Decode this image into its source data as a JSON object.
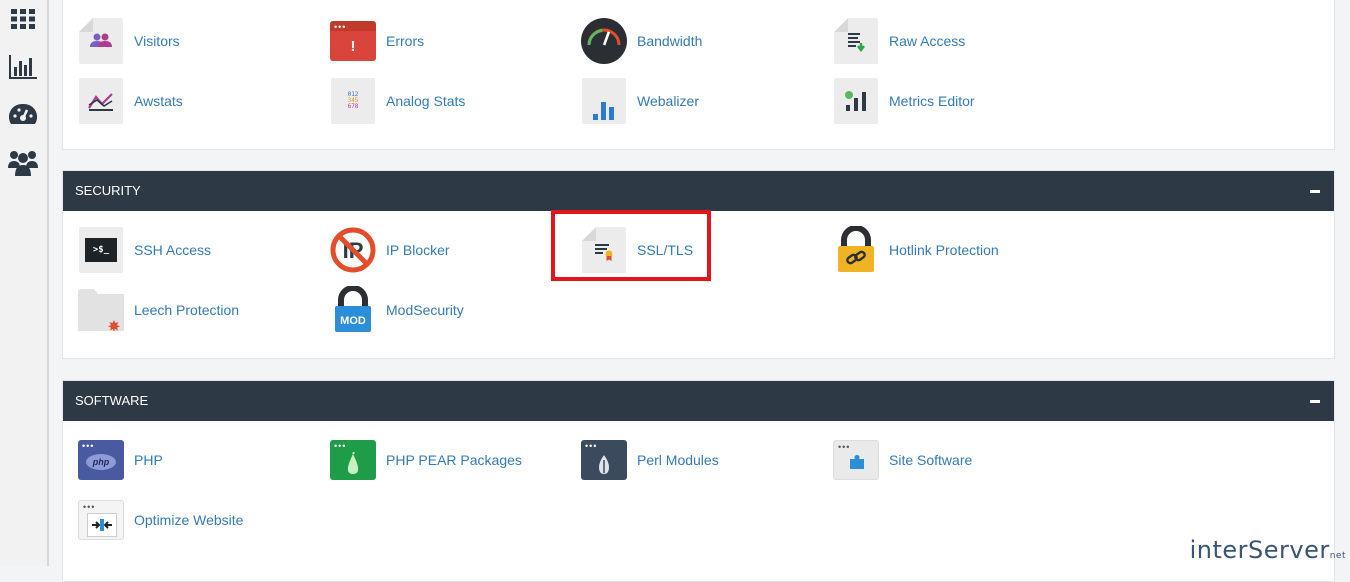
{
  "sidebar": {
    "icons": [
      "grid-icon",
      "stats-icon",
      "dashboard-gauge-icon",
      "users-icon"
    ]
  },
  "metrics": {
    "items": [
      {
        "label": "Visitors",
        "icon": "visitors-icon"
      },
      {
        "label": "Errors",
        "icon": "errors-icon"
      },
      {
        "label": "Bandwidth",
        "icon": "bandwidth-icon"
      },
      {
        "label": "Raw Access",
        "icon": "raw-access-icon"
      },
      {
        "label": "Awstats",
        "icon": "awstats-icon"
      },
      {
        "label": "Analog Stats",
        "icon": "analog-stats-icon"
      },
      {
        "label": "Webalizer",
        "icon": "webalizer-icon"
      },
      {
        "label": "Metrics Editor",
        "icon": "metrics-editor-icon"
      }
    ]
  },
  "security": {
    "title": "SECURITY",
    "items": [
      {
        "label": "SSH Access",
        "icon": "ssh-access-icon"
      },
      {
        "label": "IP Blocker",
        "icon": "ip-blocker-icon"
      },
      {
        "label": "SSL/TLS",
        "icon": "ssl-tls-icon"
      },
      {
        "label": "Hotlink Protection",
        "icon": "hotlink-protection-icon"
      },
      {
        "label": "Leech Protection",
        "icon": "leech-protection-icon"
      },
      {
        "label": "ModSecurity",
        "icon": "modsecurity-icon"
      }
    ]
  },
  "software": {
    "title": "SOFTWARE",
    "items": [
      {
        "label": "PHP",
        "icon": "php-icon"
      },
      {
        "label": "PHP PEAR Packages",
        "icon": "php-pear-icon"
      },
      {
        "label": "Perl Modules",
        "icon": "perl-modules-icon"
      },
      {
        "label": "Site Software",
        "icon": "site-software-icon"
      },
      {
        "label": "Optimize Website",
        "icon": "optimize-website-icon"
      }
    ]
  },
  "brand": {
    "name": "interServer",
    "suffix": "net"
  },
  "colors": {
    "header_bg": "#2d3a46",
    "link": "#337ab7",
    "highlight": "#e2141c"
  }
}
